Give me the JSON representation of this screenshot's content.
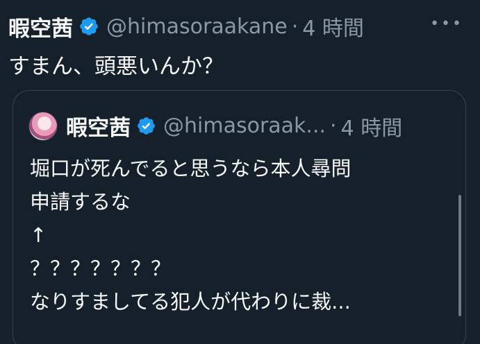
{
  "tweet": {
    "author_name": "暇空茜",
    "handle": "@himasoraakane",
    "separator": "·",
    "time": "4 時間",
    "more_icon": "more-horizontal-icon",
    "text": "すまん、頭悪いんか？"
  },
  "quote": {
    "author_name": "暇空茜",
    "handle": "@himasoraak...",
    "separator": "·",
    "time": "4 時間",
    "lines": [
      "堀口が死んでると思うなら本人尋問",
      "申請するな",
      "↑",
      "？？？？？？？",
      "なりすましてる犯人が代わりに裁..."
    ]
  },
  "colors": {
    "background": "#15202b",
    "text": "#f7f9f9",
    "secondary": "#8b98a5",
    "verified": "#1d9bf0",
    "border": "#38444d"
  }
}
